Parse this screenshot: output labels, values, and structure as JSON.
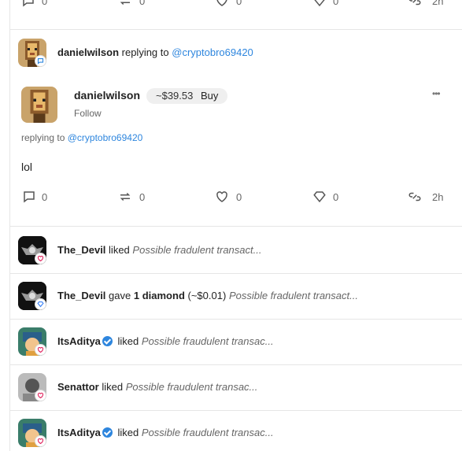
{
  "top_actions": {
    "comment_count": "0",
    "repost_count": "0",
    "like_count": "0",
    "diamond_count": "0",
    "time": "2h"
  },
  "reply": {
    "header_user": "danielwilson",
    "header_text": "replying to",
    "header_handle": "@cryptobro69420",
    "author": "danielwilson",
    "price": "~$39.53",
    "buy_label": "Buy",
    "follow_label": "Follow",
    "more_label": "•••",
    "replying_text": "replying to",
    "replying_handle": "@cryptobro69420",
    "body": "lol",
    "comment_count": "0",
    "repost_count": "0",
    "like_count": "0",
    "diamond_count": "0",
    "time": "2h"
  },
  "activity": [
    {
      "user": "The_Devil",
      "verb": "liked",
      "extra": "",
      "post": "Possible fradulent transact...",
      "badge": "heart-icon",
      "avatar": "devil"
    },
    {
      "user": "The_Devil",
      "verb": "gave",
      "extra_bold": "1 diamond",
      "extra": "(~$0.01)",
      "post": "Possible fradulent transact...",
      "badge": "diamond-icon",
      "avatar": "devil"
    },
    {
      "user": "ItsAditya",
      "verb": "liked",
      "extra": "",
      "post": "Possible fraudulent transac...",
      "badge": "heart-icon",
      "avatar": "aditya",
      "verified": true
    },
    {
      "user": "Senattor",
      "verb": "liked",
      "extra": "",
      "post": "Possible fraudulent transac...",
      "badge": "heart-icon",
      "avatar": "senattor"
    },
    {
      "user": "ItsAditya",
      "verb": "liked",
      "extra": "",
      "post": "Possible fraudulent transac...",
      "badge": "heart-icon",
      "avatar": "aditya",
      "verified": true
    }
  ],
  "colors": {
    "link": "#2e86de",
    "heart": "#e0245e",
    "diamond": "#3b82f6"
  }
}
